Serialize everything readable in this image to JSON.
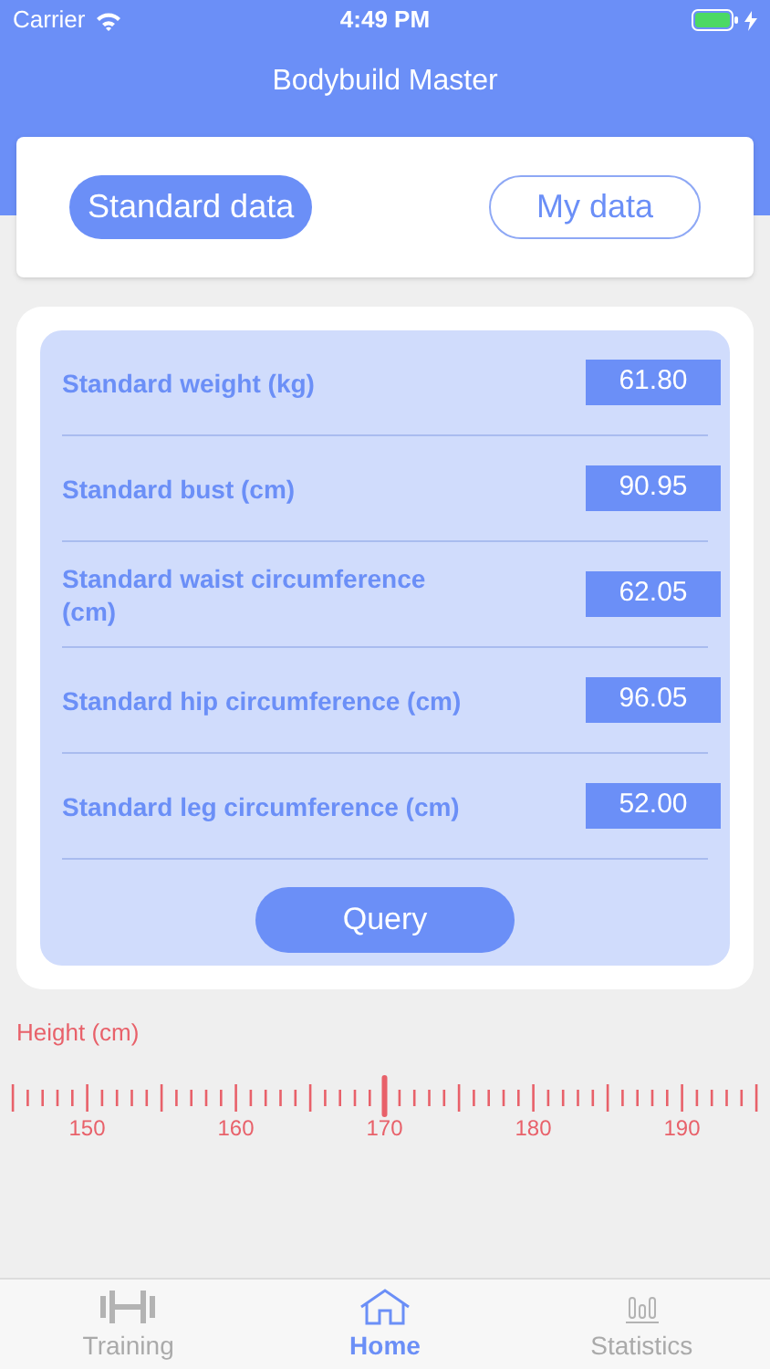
{
  "status_bar": {
    "carrier": "Carrier",
    "time": "4:49 PM"
  },
  "title": "Bodybuild Master",
  "tabs": [
    {
      "label": "Standard data",
      "selected": true
    },
    {
      "label": "My data",
      "selected": false
    }
  ],
  "measurements": [
    {
      "label": "Standard weight (kg)",
      "value": "61.80"
    },
    {
      "label": "Standard bust (cm)",
      "value": "90.95"
    },
    {
      "label": "Standard waist circumference (cm)",
      "value": "62.05"
    },
    {
      "label": "Standard hip circumference (cm)",
      "value": "96.05"
    },
    {
      "label": "Standard leg circumference (cm)",
      "value": "52.00"
    }
  ],
  "query_button": "Query",
  "height_ruler": {
    "label": "Height (cm)",
    "ticks": [
      {
        "label": "150",
        "selected": false
      },
      {
        "label": "160",
        "selected": false
      },
      {
        "label": "170",
        "selected": true
      },
      {
        "label": "180",
        "selected": false
      },
      {
        "label": "190",
        "selected": false
      }
    ]
  },
  "tab_bar": [
    {
      "label": "Training",
      "selected": false
    },
    {
      "label": "Home",
      "selected": true
    },
    {
      "label": "Statistics",
      "selected": false
    }
  ]
}
